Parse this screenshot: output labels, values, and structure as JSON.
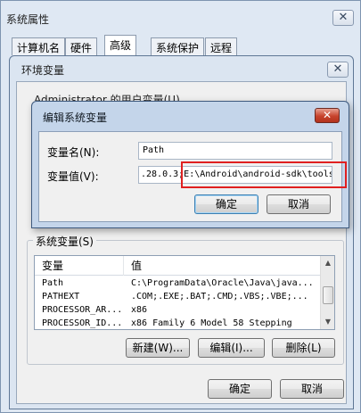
{
  "sysprop": {
    "title": "系统属性",
    "tabs": [
      "计算机名",
      "硬件",
      "高级",
      "系统保护",
      "远程"
    ],
    "active_tab": "高级"
  },
  "envvar": {
    "title": "环境变量",
    "user_vars_label_partial": "Administrator 的用户变量(U)",
    "system_vars_label": "系统变量(S)",
    "columns": [
      "变量",
      "值"
    ],
    "rows": [
      {
        "name": "Path",
        "value": "C:\\ProgramData\\Oracle\\Java\\java..."
      },
      {
        "name": "PATHEXT",
        "value": ".COM;.EXE;.BAT;.CMD;.VBS;.VBE;..."
      },
      {
        "name": "PROCESSOR_AR...",
        "value": "x86"
      },
      {
        "name": "PROCESSOR_ID...",
        "value": "x86 Family 6 Model 58 Stepping"
      }
    ],
    "new_button": "新建(W)...",
    "edit_button": "编辑(I)...",
    "delete_button": "删除(L)",
    "ok_button": "确定",
    "cancel_button": "取消"
  },
  "editdlg": {
    "title": "编辑系统变量",
    "name_label": "变量名(N):",
    "name_value": "Path",
    "value_label": "变量值(V):",
    "value_prefix": ".28.0.3;",
    "value_highlight": "E:\\Android\\android-sdk\\tools",
    "ok_button": "确定",
    "cancel_button": "取消",
    "close_glyph": "✕"
  },
  "colors": {
    "highlight_border": "#e02020",
    "close_button_red": "#c7432c",
    "default_button_border": "#3c7fb1"
  }
}
